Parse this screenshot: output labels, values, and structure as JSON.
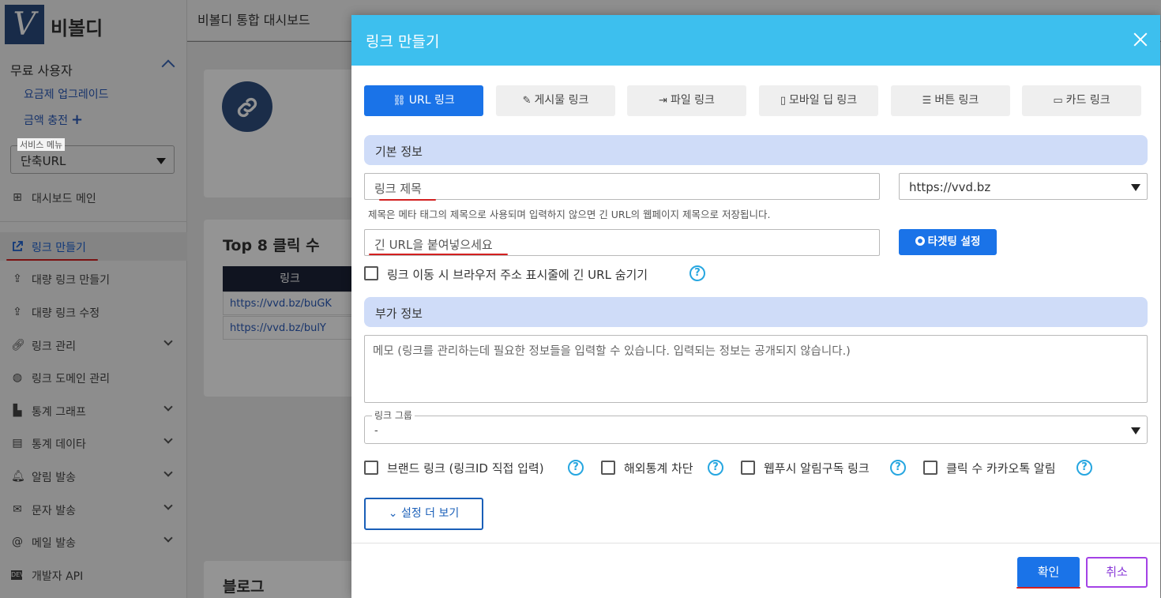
{
  "sidebar": {
    "logo_letter": "V",
    "brand": "비볼디",
    "user_type": "무료 사용자",
    "upgrade": "요금제 업그레이드",
    "charge": "금액 충전",
    "charge_plus": "+",
    "service_menu_label": "서비스 메뉴",
    "service_menu_value": "단축URL",
    "items": [
      {
        "label": "대시보드 메인",
        "icon": "grid-icon"
      },
      {
        "label": "링크 만들기",
        "icon": "external-link-icon"
      },
      {
        "label": "대량 링크 만들기",
        "icon": "upload-icon"
      },
      {
        "label": "대량 링크 수정",
        "icon": "upload-icon"
      },
      {
        "label": "링크 관리",
        "icon": "link-icon"
      },
      {
        "label": "링크 도메인 관리",
        "icon": "globe-icon"
      },
      {
        "label": "통계 그래프",
        "icon": "chart-icon"
      },
      {
        "label": "통계 데이타",
        "icon": "database-icon"
      },
      {
        "label": "알림 발송",
        "icon": "bell-icon"
      },
      {
        "label": "문자 발송",
        "icon": "envelope-icon"
      },
      {
        "label": "메일 발송",
        "icon": "at-icon"
      },
      {
        "label": "개발자 API",
        "icon": "dev-icon"
      }
    ]
  },
  "topbar": {
    "title": "비볼디 통합 대시보드"
  },
  "dashboard": {
    "top8_title": "Top 8 클릭 수",
    "table_header": "링크",
    "rows": [
      "https://vvd.bz/buGK",
      "https://vvd.bz/bulY"
    ],
    "blog_title": "블로그"
  },
  "modal": {
    "title": "링크 만들기",
    "tabs": [
      {
        "label": "URL 링크",
        "icon": "link-icon"
      },
      {
        "label": "게시물 링크",
        "icon": "edit-icon"
      },
      {
        "label": "파일 링크",
        "icon": "file-icon"
      },
      {
        "label": "모바일 딥 링크",
        "icon": "mobile-icon"
      },
      {
        "label": "버튼 링크",
        "icon": "button-icon"
      },
      {
        "label": "카드 링크",
        "icon": "card-icon"
      }
    ],
    "basic_info": "기본 정보",
    "title_placeholder": "링크 제목",
    "domain": "https://vvd.bz",
    "title_helper": "제목은 메타 태그의 제목으로 사용되며 입력하지 않으면 긴 URL의 웹페이지 제목으로 저장됩니다.",
    "url_placeholder": "긴 URL을 붙여넣으세요",
    "targeting_button": "타겟팅 설정",
    "hide_url_checkbox": "링크 이동 시 브라우저 주소 표시줄에 긴 URL 숨기기",
    "extra_info": "부가 정보",
    "memo_placeholder": "메모 (링크를 관리하는데 필요한 정보들을 입력할 수 있습니다. 입력되는 정보는 공개되지 않습니다.)",
    "group_label": "링크 그룹",
    "group_value": "-",
    "options": [
      "브랜드 링크 (링크ID 직접 입력)",
      "해외통계 차단",
      "웹푸시 알림구독 링크",
      "클릭 수 카카오톡 알림"
    ],
    "more_settings": "설정 더 보기",
    "ok": "확인",
    "cancel": "취소"
  },
  "colors": {
    "header": "#3dbfee",
    "primary": "#1a73e8",
    "section": "#cfdcf8",
    "cancel_border": "#a442e6",
    "annotation": "#d32020"
  }
}
